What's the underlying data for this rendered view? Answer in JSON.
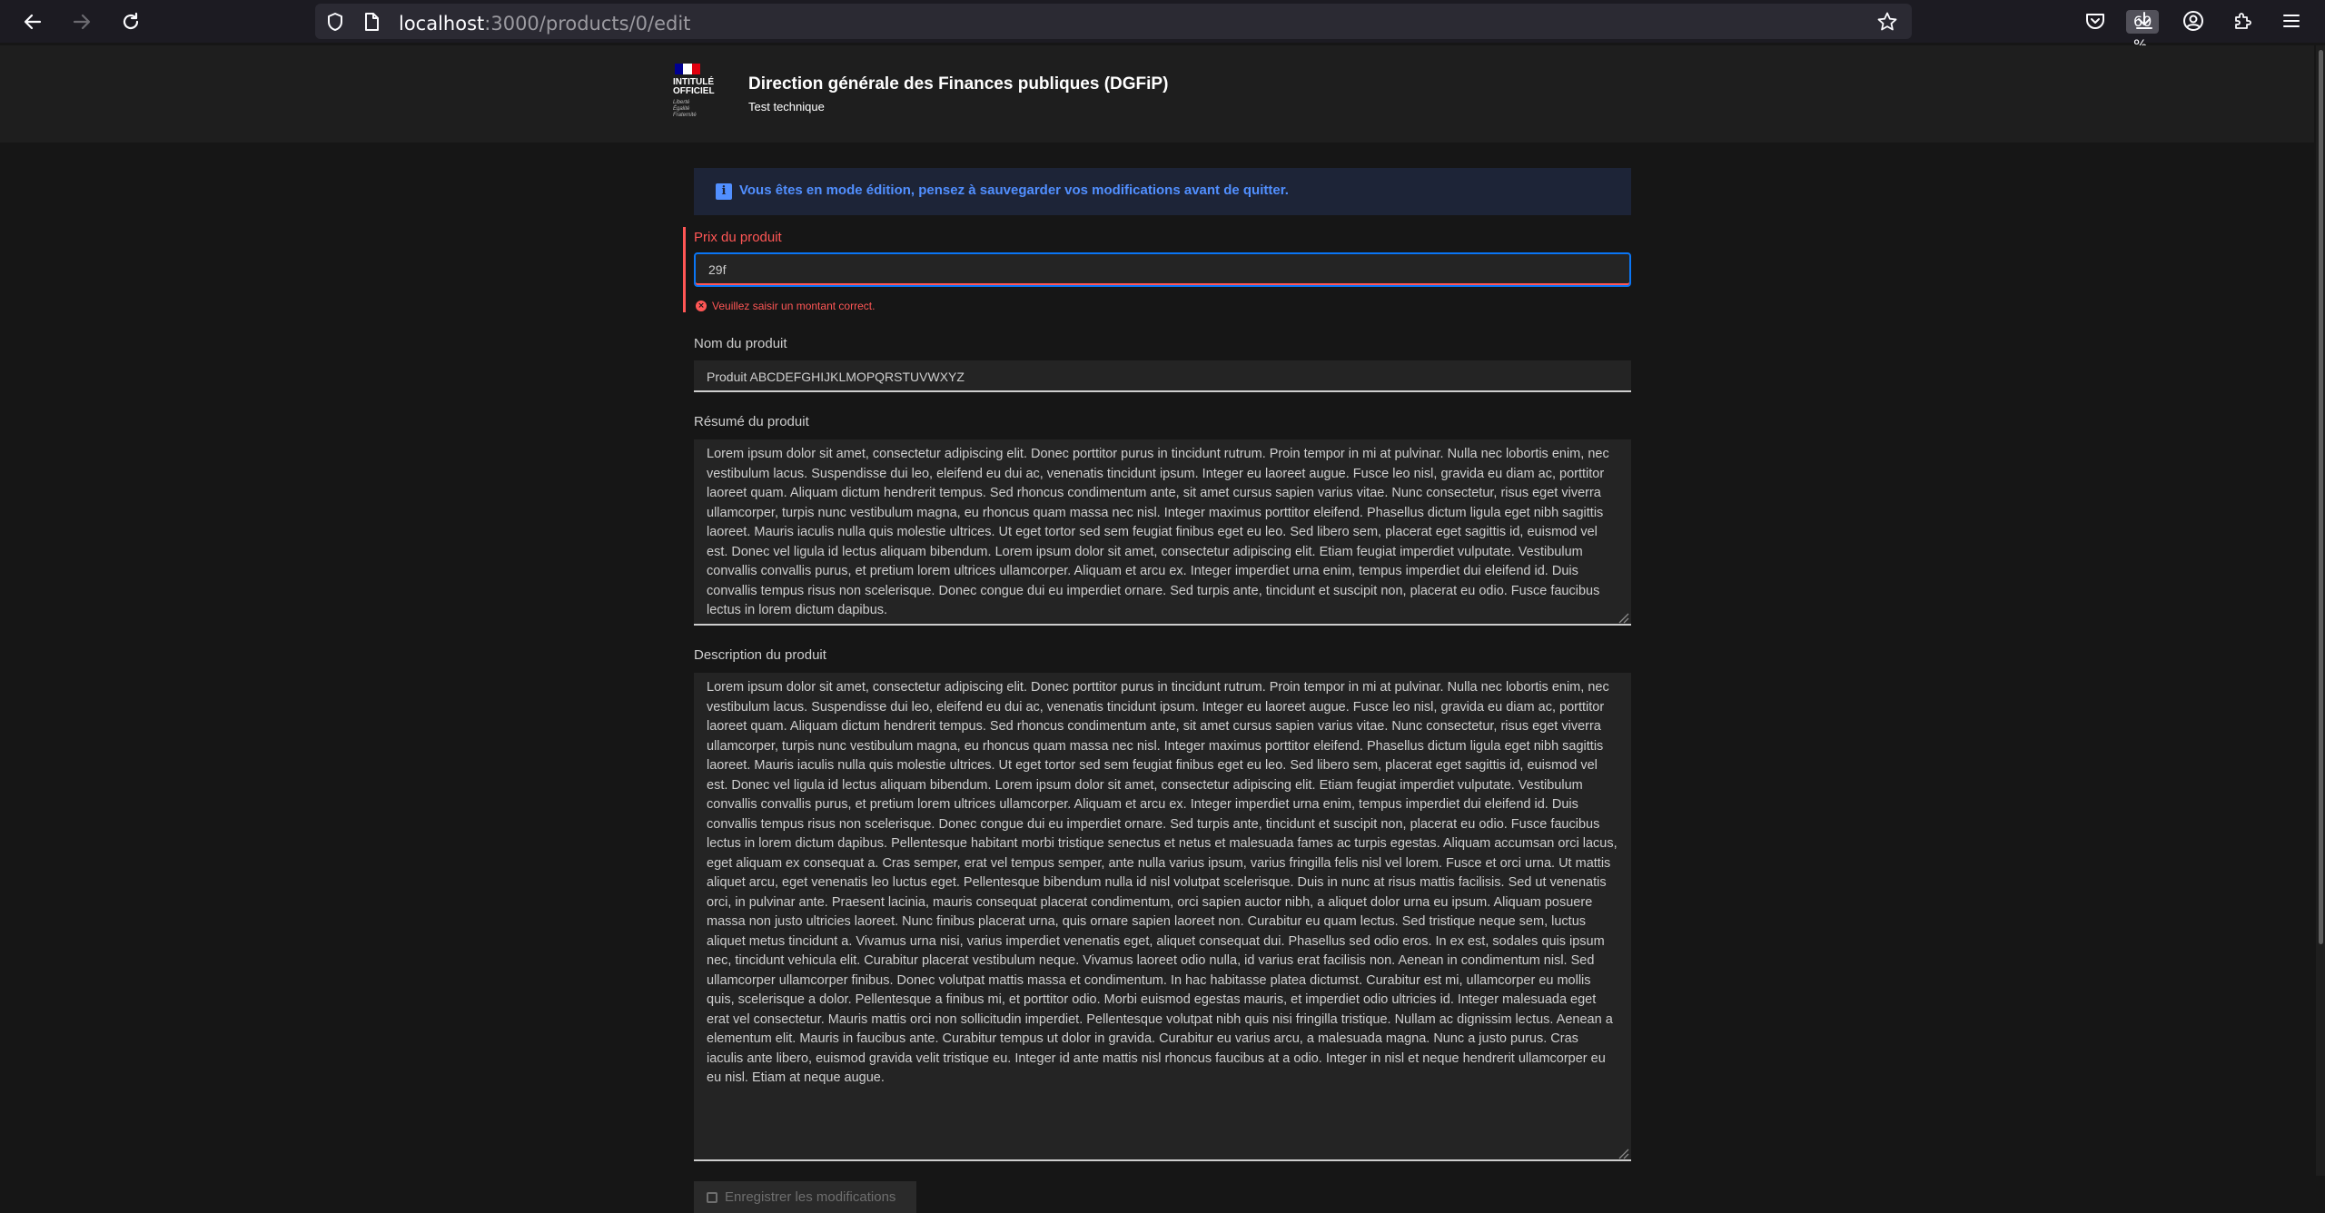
{
  "browser": {
    "url_host": "localhost",
    "url_path": ":3000/products/0/edit",
    "zoom": "60 %"
  },
  "header": {
    "logo_lines": [
      "INTITULÉ",
      "OFFICIEL"
    ],
    "logo_devise": [
      "Liberté",
      "Égalité",
      "Fraternité"
    ],
    "title": "Direction générale des Finances publiques (DGFiP)",
    "tagline": "Test technique"
  },
  "alert": {
    "icon": "info-icon",
    "text": "Vous êtes en mode édition, pensez à sauvegarder vos modifications avant de quitter."
  },
  "form": {
    "price": {
      "label": "Prix du produit",
      "value": "29f",
      "error": "Veuillez saisir un montant correct."
    },
    "name": {
      "label": "Nom du produit",
      "value": "Produit ABCDEFGHIJKLMOPQRSTUVWXYZ"
    },
    "resume": {
      "label": "Résumé du produit",
      "value": "Lorem ipsum dolor sit amet, consectetur adipiscing elit. Donec porttitor purus in tincidunt rutrum. Proin tempor in mi at pulvinar. Nulla nec lobortis enim, nec vestibulum lacus. Suspendisse dui leo, eleifend eu dui ac, venenatis tincidunt ipsum. Integer eu laoreet augue. Fusce leo nisl, gravida eu diam ac, porttitor laoreet quam. Aliquam dictum hendrerit tempus. Sed rhoncus condimentum ante, sit amet cursus sapien varius vitae. Nunc consectetur, risus eget viverra ullamcorper, turpis nunc vestibulum magna, eu rhoncus quam massa nec nisl. Integer maximus porttitor eleifend. Phasellus dictum ligula eget nibh sagittis laoreet. Mauris iaculis nulla quis molestie ultrices. Ut eget tortor sed sem feugiat finibus eget eu leo. Sed libero sem, placerat eget sagittis id, euismod vel est. Donec vel ligula id lectus aliquam bibendum. Lorem ipsum dolor sit amet, consectetur adipiscing elit. Etiam feugiat imperdiet vulputate. Vestibulum convallis convallis purus, et pretium lorem ultrices ullamcorper. Aliquam et arcu ex. Integer imperdiet urna enim, tempus imperdiet dui eleifend id. Duis convallis tempus risus non scelerisque. Donec congue dui eu imperdiet ornare. Sed turpis ante, tincidunt et suscipit non, placerat eu odio. Fusce faucibus lectus in lorem dictum dapibus."
    },
    "description": {
      "label": "Description du produit",
      "value": "Lorem ipsum dolor sit amet, consectetur adipiscing elit. Donec porttitor purus in tincidunt rutrum. Proin tempor in mi at pulvinar. Nulla nec lobortis enim, nec vestibulum lacus. Suspendisse dui leo, eleifend eu dui ac, venenatis tincidunt ipsum. Integer eu laoreet augue. Fusce leo nisl, gravida eu diam ac, porttitor laoreet quam. Aliquam dictum hendrerit tempus. Sed rhoncus condimentum ante, sit amet cursus sapien varius vitae. Nunc consectetur, risus eget viverra ullamcorper, turpis nunc vestibulum magna, eu rhoncus quam massa nec nisl. Integer maximus porttitor eleifend. Phasellus dictum ligula eget nibh sagittis laoreet. Mauris iaculis nulla quis molestie ultrices. Ut eget tortor sed sem feugiat finibus eget eu leo. Sed libero sem, placerat eget sagittis id, euismod vel est. Donec vel ligula id lectus aliquam bibendum. Lorem ipsum dolor sit amet, consectetur adipiscing elit. Etiam feugiat imperdiet vulputate. Vestibulum convallis convallis purus, et pretium lorem ultrices ullamcorper. Aliquam et arcu ex. Integer imperdiet urna enim, tempus imperdiet dui eleifend id. Duis convallis tempus risus non scelerisque. Donec congue dui eu imperdiet ornare. Sed turpis ante, tincidunt et suscipit non, placerat eu odio. Fusce faucibus lectus in lorem dictum dapibus. Pellentesque habitant morbi tristique senectus et netus et malesuada fames ac turpis egestas. Aliquam accumsan orci lacus, eget aliquam ex consequat a. Cras semper, erat vel tempus semper, ante nulla varius ipsum, varius fringilla felis nisl vel lorem. Fusce et orci urna. Ut mattis aliquet arcu, eget venenatis leo luctus eget. Pellentesque bibendum nulla id nisl volutpat scelerisque. Duis in nunc at risus mattis facilisis. Sed ut venenatis orci, in pulvinar ante. Praesent lacinia, mauris consequat placerat condimentum, orci sapien auctor nibh, a aliquet dolor urna eu ipsum. Aliquam posuere massa non justo ultricies laoreet. Nunc finibus placerat urna, quis ornare sapien laoreet non. Curabitur eu quam lectus. Sed tristique neque sem, luctus aliquet metus tincidunt a. Vivamus urna nisi, varius imperdiet venenatis eget, aliquet consequat dui. Phasellus sed odio eros. In ex est, sodales quis ipsum nec, tincidunt vehicula elit. Curabitur placerat vestibulum neque. Vivamus laoreet odio nulla, id varius erat facilisis non. Aenean in condimentum nisl. Sed ullamcorper ullamcorper finibus. Donec volutpat mattis massa et condimentum. In hac habitasse platea dictumst. Curabitur est mi, ullamcorper eu mollis quis, scelerisque a dolor. Pellentesque a finibus mi, et porttitor odio. Morbi euismod egestas mauris, et imperdiet odio ultricies id. Integer malesuada eget erat vel consectetur. Mauris mattis orci non sollicitudin imperdiet. Pellentesque volutpat nibh quis nisi fringilla tristique. Nullam ac dignissim lectus. Aenean a elementum elit. Mauris in faucibus ante. Curabitur tempus ut dolor in gravida. Curabitur eu varius arcu, a malesuada magna. Nunc a justo purus. Cras iaculis ante libero, euismod gravida velit tristique eu. Integer id ante mattis nisl rhoncus faucibus at a odio. Integer in nisl et neque hendrerit ullamcorper eu eu nisl. Etiam at neque augue."
    },
    "save_label": "Enregistrer les modifications"
  },
  "colors": {
    "error": "#ff5655",
    "info": "#518fff",
    "focus": "#0a76f6",
    "flag_blue": "#000091",
    "flag_red": "#e1000f"
  }
}
